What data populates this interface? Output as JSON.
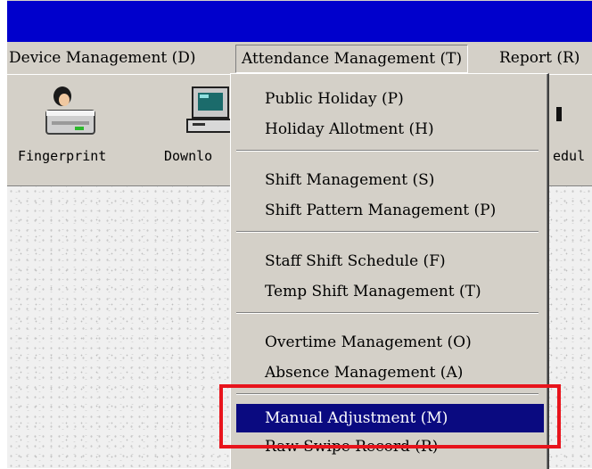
{
  "menubar": {
    "items": [
      {
        "label": "Device Management (D)"
      },
      {
        "label": "Attendance Management (T)"
      },
      {
        "label": "Report (R)"
      }
    ]
  },
  "toolbar": {
    "buttons": [
      {
        "label": "Fingerprint",
        "icon": "fingerprint-reader-icon"
      },
      {
        "label": "Downlo",
        "icon": "download-computer-icon"
      },
      {
        "label": "edul",
        "icon": "schedule-icon"
      }
    ]
  },
  "dropdown": {
    "items": [
      {
        "label": "Public Holiday (P)"
      },
      {
        "label": "Holiday Allotment (H)"
      },
      {
        "label": "Shift Management (S)"
      },
      {
        "label": "Shift Pattern Management (P)"
      },
      {
        "label": "Staff Shift Schedule (F)"
      },
      {
        "label": "Temp Shift Management (T)"
      },
      {
        "label": "Overtime Management (O)"
      },
      {
        "label": "Absence Management (A)"
      },
      {
        "label": "Manual Adjustment (M)"
      },
      {
        "label": "Raw Swipe Record (R)"
      }
    ],
    "highlighted_item": "Manual Adjustment (M)"
  },
  "colors": {
    "titlebar": "#0000cc",
    "highlight": "#0a0a80",
    "annotation": "#e8141c",
    "face": "#d4d0c8"
  }
}
